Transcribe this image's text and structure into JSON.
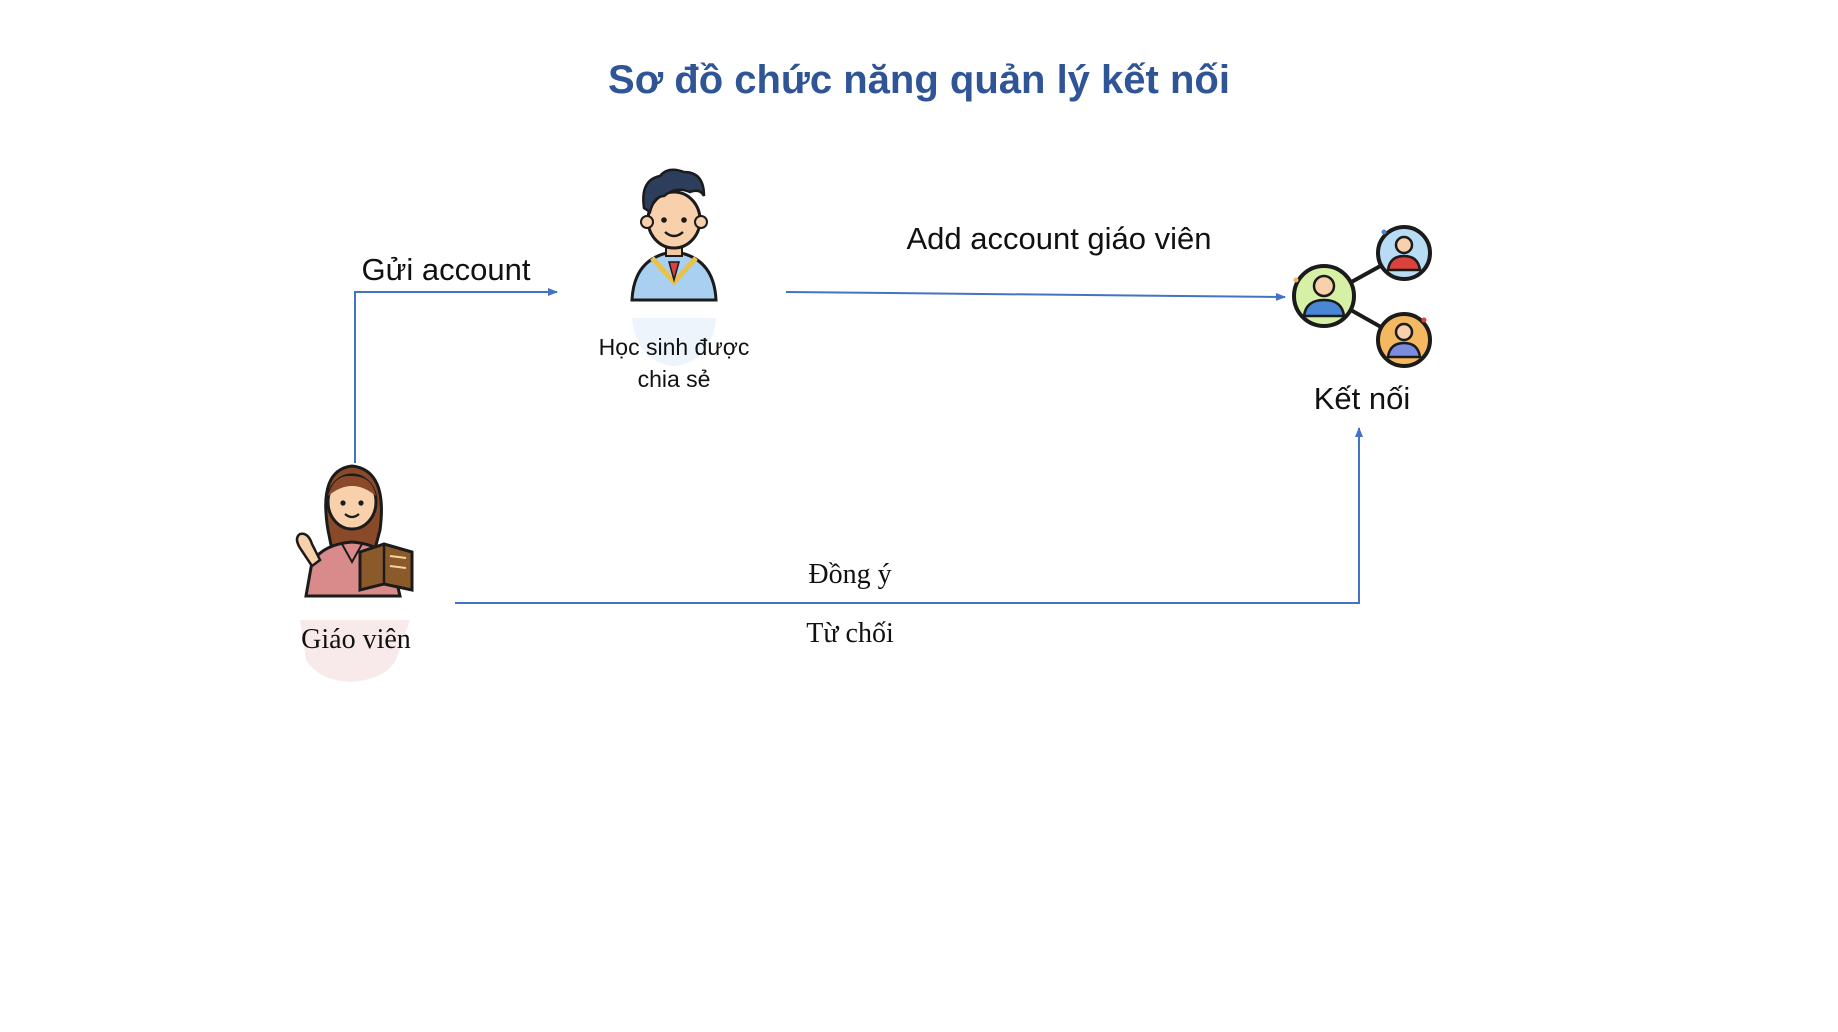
{
  "diagram": {
    "title": "Sơ đồ chức năng quản lý kết nối",
    "nodes": {
      "teacher": {
        "label": "Giáo viên",
        "icon": "teacher-icon"
      },
      "student": {
        "label_line1": "Học sinh được",
        "label_line2": "chia sẻ",
        "icon": "student-icon"
      },
      "connection": {
        "label": "Kết nối",
        "icon": "network-icon"
      }
    },
    "edges": {
      "send_account": "Gửi account",
      "add_account": "Add account giáo viên",
      "accept": "Đồng ý",
      "reject": "Từ chối"
    },
    "colors": {
      "title": "#2f5597",
      "connector": "#4472c4"
    }
  }
}
